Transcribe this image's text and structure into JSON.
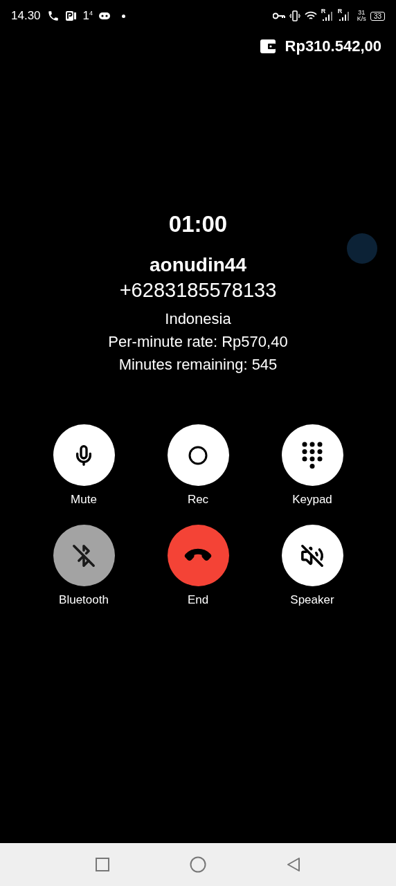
{
  "status_bar": {
    "time": "14.30",
    "sim_label": "1",
    "sim_sup": "4",
    "signal_labels": [
      "R",
      "R"
    ],
    "speed_value": "31",
    "speed_unit": "K/s",
    "battery": "33"
  },
  "balance": "Rp310.542,00",
  "call": {
    "timer": "01:00",
    "name": "aonudin44",
    "number": "+6283185578133",
    "country": "Indonesia",
    "rate": "Per-minute rate: Rp570,40",
    "remaining": "Minutes remaining: 545"
  },
  "controls": [
    {
      "kind": "mute",
      "label": "Mute",
      "disabled": false
    },
    {
      "kind": "rec",
      "label": "Rec",
      "disabled": false
    },
    {
      "kind": "keypad",
      "label": "Keypad",
      "disabled": false
    },
    {
      "kind": "bluetooth",
      "label": "Bluetooth",
      "disabled": true
    },
    {
      "kind": "end",
      "label": "End",
      "disabled": false
    },
    {
      "kind": "speaker",
      "label": "Speaker",
      "disabled": false
    }
  ]
}
